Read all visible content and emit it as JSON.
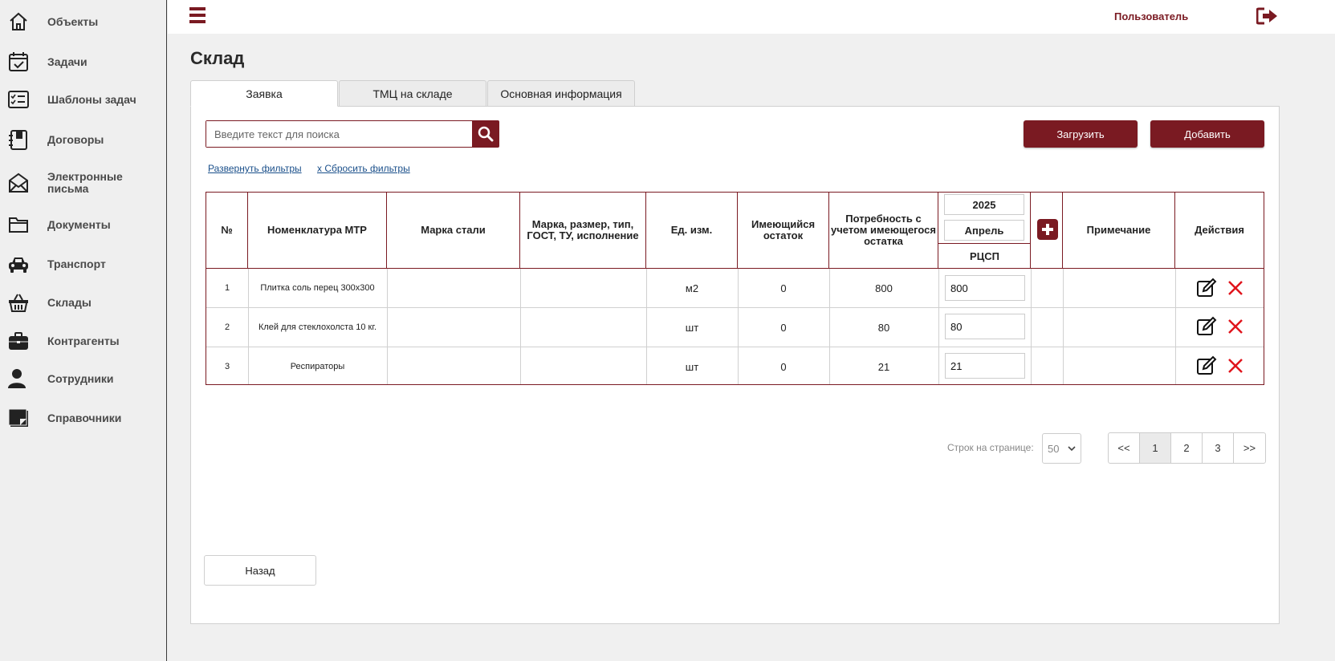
{
  "sidebar": {
    "items": [
      {
        "label": "Объекты",
        "icon": "home-icon"
      },
      {
        "label": "Задачи",
        "icon": "calendar-check-icon"
      },
      {
        "label": "Шаблоны задач",
        "icon": "checklist-icon"
      },
      {
        "label": "Договоры",
        "icon": "notebook-icon"
      },
      {
        "label": "Электронные письма",
        "icon": "envelope-icon"
      },
      {
        "label": "Документы",
        "icon": "folder-icon"
      },
      {
        "label": "Транспорт",
        "icon": "car-icon"
      },
      {
        "label": "Склады",
        "icon": "basket-icon"
      },
      {
        "label": "Контрагенты",
        "icon": "briefcase-icon"
      },
      {
        "label": "Сотрудники",
        "icon": "person-icon"
      },
      {
        "label": "Справочники",
        "icon": "sticky-note-icon"
      }
    ]
  },
  "topbar": {
    "user_label": "Пользователь"
  },
  "page": {
    "title": "Склад"
  },
  "tabs": [
    {
      "label": "Заявка",
      "active": true
    },
    {
      "label": "ТМЦ на складе",
      "active": false
    },
    {
      "label": "Основная информация",
      "active": false
    }
  ],
  "search": {
    "placeholder": "Введите текст для поиска",
    "value": ""
  },
  "toolbar": {
    "upload_label": "Загрузить",
    "add_label": "Добавить"
  },
  "filters": {
    "expand_label": "Развернуть фильтры",
    "reset_label": "x Сбросить фильтры"
  },
  "table": {
    "headers": {
      "num": "№",
      "nomenclature": "Номенклатура МТР",
      "steel": "Марка стали",
      "spec": "Марка, размер, тип, ГОСТ, ТУ, исполнение",
      "unit": "Ед. изм.",
      "stock": "Имеющийся остаток",
      "need": "Потребность с учетом имеющегося остатка",
      "year": "2025",
      "month": "Апрель",
      "rcsp": "РЦСП",
      "note": "Примечание",
      "actions": "Действия"
    },
    "rows": [
      {
        "num": "1",
        "name": "Плитка соль перец 300х300",
        "steel": "",
        "spec": "",
        "unit": "м2",
        "stock": "0",
        "need": "800",
        "rcsp": "800",
        "note": ""
      },
      {
        "num": "2",
        "name": "Клей для стеклохолста 10 кг.",
        "steel": "",
        "spec": "",
        "unit": "шт",
        "stock": "0",
        "need": "80",
        "rcsp": "80",
        "note": ""
      },
      {
        "num": "3",
        "name": "Респираторы",
        "steel": "",
        "spec": "",
        "unit": "шт",
        "stock": "0",
        "need": "21",
        "rcsp": "21",
        "note": ""
      }
    ]
  },
  "pagination": {
    "rows_label": "Строк на странице:",
    "rows_value": "50",
    "first": "<<",
    "pages": [
      "1",
      "2",
      "3"
    ],
    "current": "1",
    "last": ">>"
  },
  "footer": {
    "back_label": "Назад"
  },
  "colors": {
    "accent": "#7a1a22",
    "delete": "#e0141c",
    "link": "#1a4f8a"
  }
}
